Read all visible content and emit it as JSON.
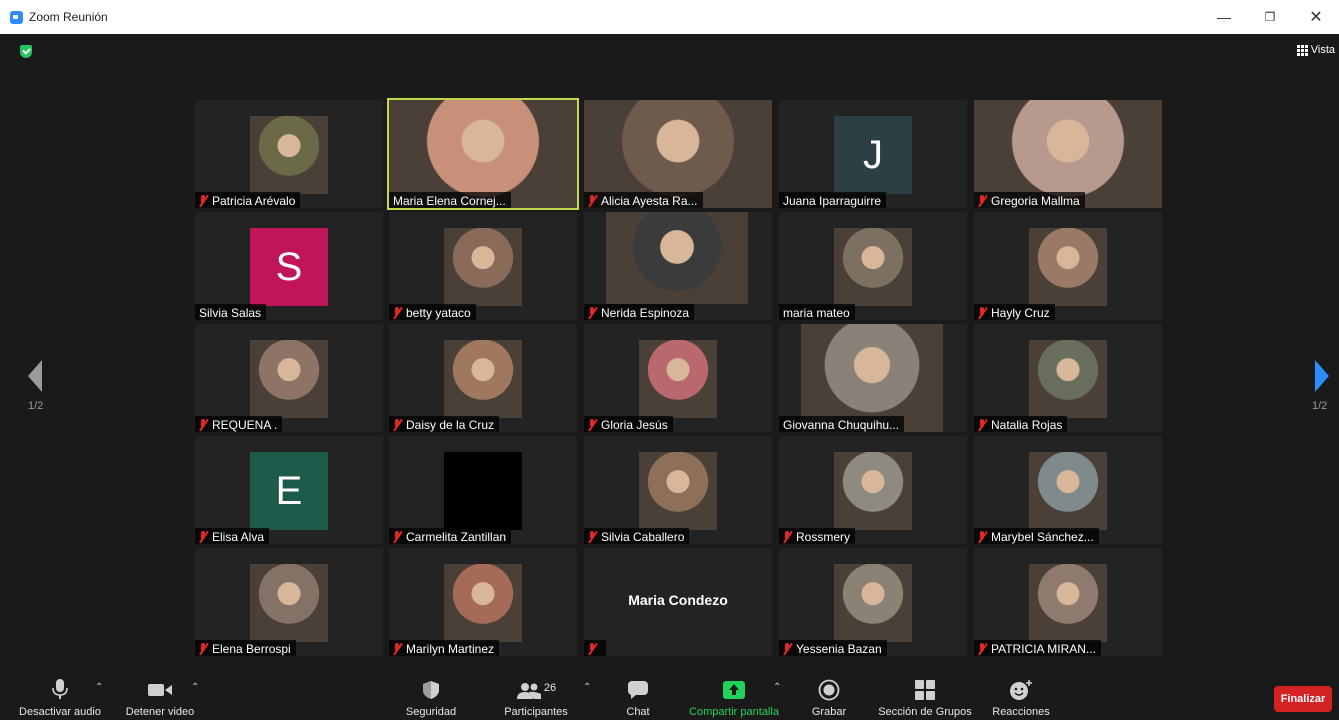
{
  "window": {
    "title": "Zoom Reunión"
  },
  "view_button": {
    "label": "Vista"
  },
  "pagination": {
    "left": "1/2",
    "right": "1/2"
  },
  "tiles": [
    {
      "name": "Patricia Arévalo",
      "muted": true
    },
    {
      "name": "Maria Elena Cornej...",
      "muted": false,
      "active": true
    },
    {
      "name": "Alicia Ayesta Ra...",
      "muted": true
    },
    {
      "name": "Juana Iparraguirre",
      "muted": false,
      "letter": "J",
      "color": "#2d3e45"
    },
    {
      "name": "Gregoria Mallma",
      "muted": true
    },
    {
      "name": "Silvia Salas",
      "muted": false,
      "letter": "S",
      "color": "#c0155a"
    },
    {
      "name": "betty yataco",
      "muted": true
    },
    {
      "name": "Nerida Espinoza",
      "muted": true
    },
    {
      "name": "maria mateo",
      "muted": false
    },
    {
      "name": "Hayly Cruz",
      "muted": true
    },
    {
      "name": "REQUENA .",
      "muted": true
    },
    {
      "name": "Daisy de la Cruz",
      "muted": true
    },
    {
      "name": "Gloria Jesús",
      "muted": true
    },
    {
      "name": "Giovanna Chuquihu...",
      "muted": false
    },
    {
      "name": "Natalia Rojas",
      "muted": true
    },
    {
      "name": "Elisa Alva",
      "muted": true,
      "letter": "E",
      "color": "#1e5b4a"
    },
    {
      "name": "Carmelita Zantillan",
      "muted": true
    },
    {
      "name": "Silvia Caballero",
      "muted": true
    },
    {
      "name": "Rossmery",
      "muted": true
    },
    {
      "name": "Marybel Sánchez...",
      "muted": true
    },
    {
      "name": "Elena Berrospi",
      "muted": true
    },
    {
      "name": "Marilyn Martinez",
      "muted": true
    },
    {
      "name": "",
      "muted": true,
      "bigname": "Maria Condezo"
    },
    {
      "name": "Yessenia Bazan",
      "muted": true
    },
    {
      "name": "PATRICIA MIRAN...",
      "muted": true
    }
  ],
  "toolbar": {
    "mute_label": "Desactivar audio",
    "video_label": "Detener video",
    "security_label": "Seguridad",
    "participants_label": "Participantes",
    "participants_count": "26",
    "chat_label": "Chat",
    "share_label": "Compartir pantalla",
    "record_label": "Grabar",
    "breakout_label": "Sección de Grupos",
    "reactions_label": "Reacciones",
    "end_label": "Finalizar"
  },
  "colors": {
    "accent_green": "#22d15c",
    "end_red": "#d32222",
    "active_border": "#c4d94a",
    "mute_red": "#e02828"
  },
  "icons": [
    "zoom-app-icon",
    "shield-icon",
    "grid-icon",
    "microphone-icon",
    "video-camera-icon",
    "security-shield-icon",
    "participants-icon",
    "chat-icon",
    "share-screen-icon",
    "record-icon",
    "breakout-rooms-icon",
    "reactions-icon",
    "mic-muted-icon",
    "chevron-left-icon",
    "chevron-right-icon"
  ]
}
